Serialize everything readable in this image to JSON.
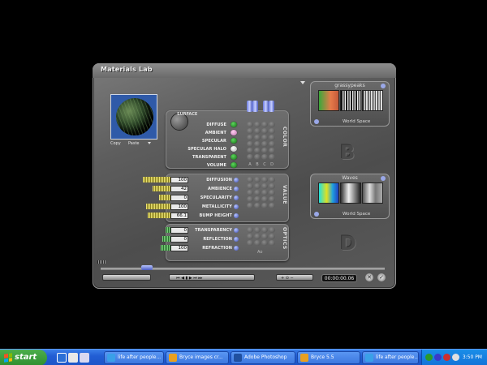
{
  "window": {
    "title": "Materials Lab"
  },
  "preview": {
    "copy_label": "Copy",
    "paste_label": "Paste"
  },
  "surface": {
    "header": "SURFACE",
    "side_label": "COLOR",
    "rows": [
      {
        "label": "DIFFUSE",
        "dot": "green"
      },
      {
        "label": "AMBIENT",
        "dot": "pink"
      },
      {
        "label": "SPECULAR",
        "dot": "green"
      },
      {
        "label": "SPECULAR HALO",
        "dot": "white"
      },
      {
        "label": "TRANSPARENT",
        "dot": "green"
      },
      {
        "label": "VOLUME",
        "dot": "green"
      }
    ],
    "columns": [
      "A",
      "B",
      "C",
      "D"
    ]
  },
  "value_section": {
    "side_label": "VALUE",
    "rows": [
      {
        "value": "100",
        "label": "DIFFUSION"
      },
      {
        "value": "42",
        "label": "AMBIENCE"
      },
      {
        "value": "0",
        "label": "SPECULARITY"
      },
      {
        "value": "100",
        "label": "METALLICITY"
      },
      {
        "value": "66.1",
        "label": "BUMP HEIGHT"
      }
    ]
  },
  "optics_section": {
    "side_label": "OPTICS",
    "rows": [
      {
        "value": "0",
        "label": "TRANSPARENCY"
      },
      {
        "value": "0",
        "label": "REFLECTION"
      },
      {
        "value": "100",
        "label": "REFRACTION"
      }
    ],
    "footer": "Ao"
  },
  "channel_b": {
    "title": "grassypeaks",
    "space": "World Space",
    "letter": "B"
  },
  "channel_c": {
    "title": "Waves",
    "space": "World Space",
    "letter": "D"
  },
  "timeline": {
    "timecode": "00:00:00.06"
  },
  "taskbar": {
    "start_label": "start",
    "tasks": [
      {
        "label": "life after people..."
      },
      {
        "label": "Bryce images cr..."
      },
      {
        "label": "Adobe Photoshop"
      },
      {
        "label": "Bryce 5.5"
      },
      {
        "label": "life after people..."
      }
    ],
    "clock": "3:50 PM"
  },
  "colors": {
    "accent_green": "#2f8e2f",
    "taskbar_blue": "#225ed4"
  }
}
